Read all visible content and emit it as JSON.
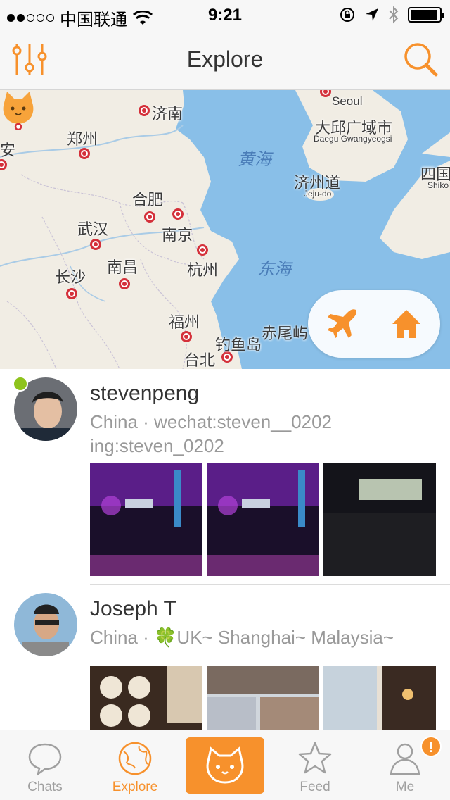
{
  "status_bar": {
    "carrier": "中国联通",
    "time": "9:21",
    "battery_level": 0.95
  },
  "nav": {
    "title": "Explore",
    "left_icon": "filter-sliders-icon",
    "right_icon": "search-icon"
  },
  "map": {
    "cities": [
      {
        "label": "济南"
      },
      {
        "label": "郑州"
      },
      {
        "label": "安"
      },
      {
        "label": "合肥"
      },
      {
        "label": "南京"
      },
      {
        "label": "武汉"
      },
      {
        "label": "长沙"
      },
      {
        "label": "南昌"
      },
      {
        "label": "杭州"
      },
      {
        "label": "福州"
      },
      {
        "label": "台北"
      },
      {
        "label": "钓鱼岛"
      },
      {
        "label": "赤尾屿"
      },
      {
        "label": "济州道"
      },
      {
        "label": "大邱广域市"
      },
      {
        "label": "Seoul"
      },
      {
        "label": "四国"
      }
    ],
    "small_labels": {
      "jeju": "Jeju-do",
      "daegu": "Daegu Gwangyeogsi",
      "shikoku": "Shiko"
    },
    "seas": {
      "yellow_sea": "黄海",
      "east_sea": "东海"
    },
    "controls": {
      "plane_icon": "airplane-icon",
      "home_icon": "home-icon"
    }
  },
  "feed": [
    {
      "name": "stevenpeng",
      "info_line1": "China · wechat:steven__0202",
      "info_line2": "ing:steven_0202",
      "online": true
    },
    {
      "name": "Joseph T",
      "info_line1": "China · 🍀UK~ Shanghai~ Malaysia~",
      "online": false
    }
  ],
  "tabbar": {
    "tabs": [
      {
        "label": "Chats",
        "icon": "chat-bubble-icon"
      },
      {
        "label": "Explore",
        "icon": "globe-icon",
        "active": true
      },
      {
        "label": "",
        "icon": "cat-face-icon"
      },
      {
        "label": "Feed",
        "icon": "star-icon"
      },
      {
        "label": "Me",
        "icon": "person-icon",
        "badge": "!"
      }
    ]
  },
  "colors": {
    "accent": "#f7912c",
    "online": "#8ec31c",
    "sea": "#89bfe8",
    "land": "#f1ede4"
  }
}
